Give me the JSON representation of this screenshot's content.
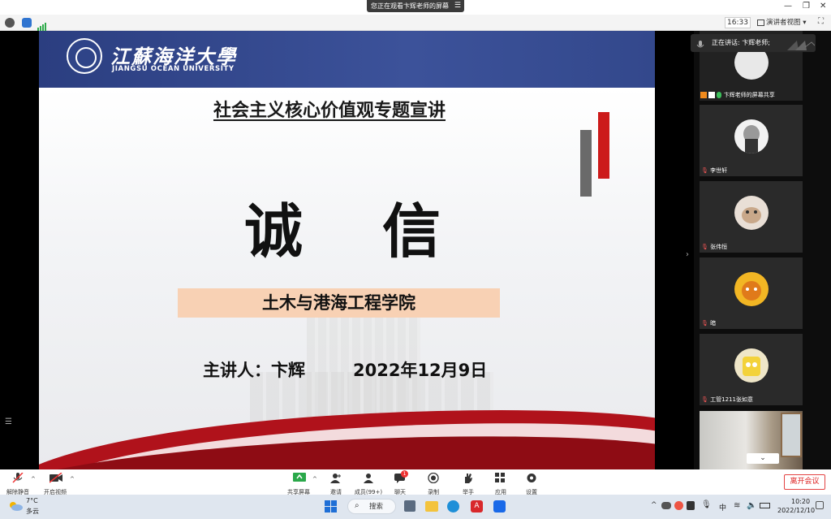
{
  "window": {
    "share_banner": "您正在观看卞辉老师的屏幕",
    "share_menu_icon": "list-icon"
  },
  "topbar": {
    "time": "16:33",
    "view_mode": "演讲者视图"
  },
  "slide": {
    "logo_cn": "江蘇海洋大學",
    "logo_en": "JIANGSU OCEAN UNIVERSITY",
    "title": "社会主义核心价值观专题宣讲",
    "main_char_1": "诚",
    "main_char_2": "信",
    "college": "土木与港海工程学院",
    "speaker": "主讲人：卞辉",
    "date": "2022年12月9日"
  },
  "right_panel": {
    "speaking_label": "正在讲话: 卞辉老师;",
    "participants": [
      {
        "name": "卞辉老师的屏幕共享"
      },
      {
        "name": "李世轩"
      },
      {
        "name": "张伟恒"
      },
      {
        "name": "暗"
      },
      {
        "name": "工管1211张如意"
      }
    ]
  },
  "toolbar": {
    "mute_label": "解除静音",
    "video_label": "开启视频",
    "share_label": "共享屏幕",
    "invite_label": "邀请",
    "members_label": "成员(99+)",
    "chat_label": "聊天",
    "chat_badge": "1",
    "record_label": "录制",
    "hand_label": "举手",
    "apps_label": "应用",
    "settings_label": "设置",
    "leave_label": "离开会议"
  },
  "taskbar": {
    "weather_temp": "7°C",
    "weather_desc": "多云",
    "search_label": "搜索",
    "ime": "中",
    "time": "10:20",
    "date": "2022/12/10"
  },
  "colors": {
    "header_blue": "#2b3e80",
    "accent_red": "#cc1a1a",
    "college_bg": "#f8d1b4",
    "leave_red": "#e34242"
  }
}
